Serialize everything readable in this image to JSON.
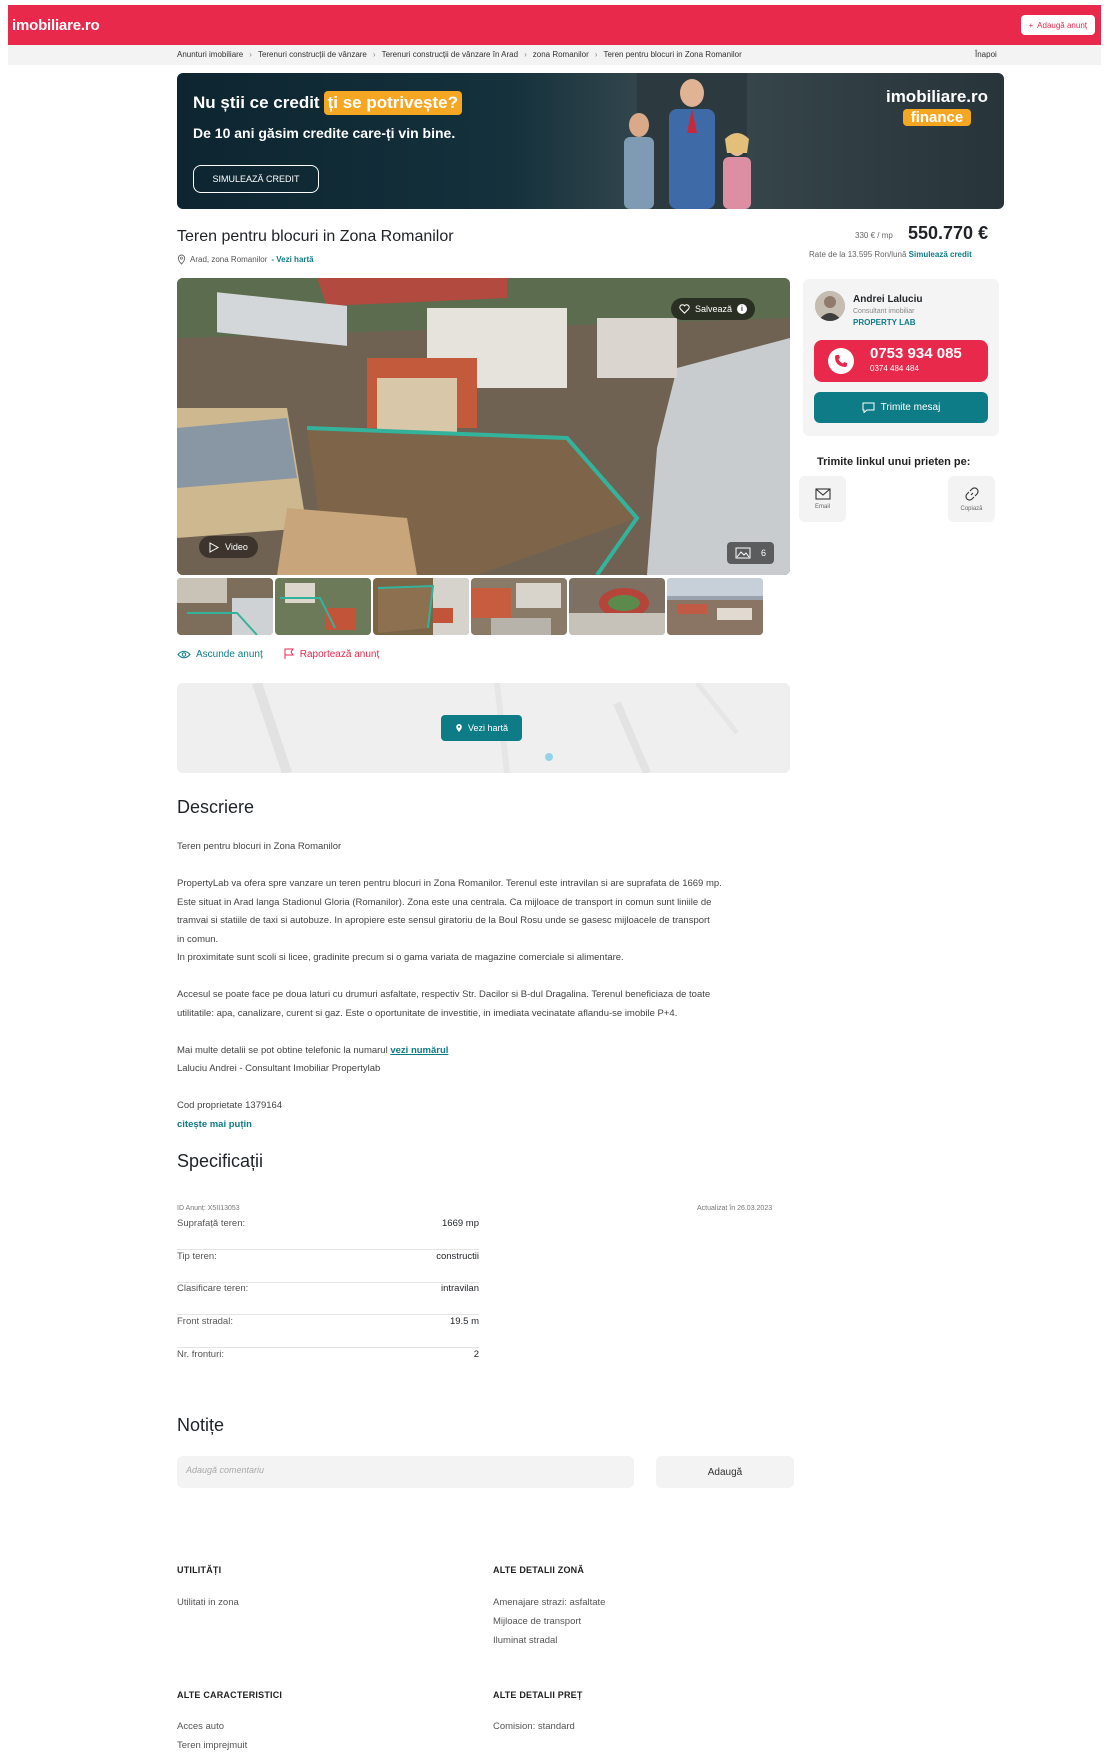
{
  "header": {
    "logo": "imobiliare.ro",
    "add_listing": "Adaugă anunț"
  },
  "breadcrumb": {
    "items": [
      "Anunturi imobiliare",
      "Terenuri construcții de vânzare",
      "Terenuri construcții de vânzare în Arad",
      "zona Romanilor",
      "Teren pentru blocuri in Zona Romanilor"
    ],
    "back": "Înapoi"
  },
  "banner": {
    "line1_a": "Nu știi ce credit",
    "line1_b": "ți se potrivește?",
    "line2": "De 10 ani găsim credite care-ți vin bine.",
    "cta": "SIMULEAZĂ CREDIT",
    "brand": "imobiliare.ro",
    "brand_sub": "finance"
  },
  "listing": {
    "title": "Teren pentru blocuri in Zona Romanilor",
    "location": "Arad, zona Romanilor",
    "map_link": "- Vezi hartă",
    "price_per_sqm": "330 € / mp",
    "price": "550.770 €",
    "rates_text": "Rate de la 13.595 Ron/lună",
    "rates_link": "Simulează credit"
  },
  "gallery": {
    "save": "Salvează",
    "info": "i",
    "video": "Video",
    "count": "6"
  },
  "actions": {
    "hide": "Ascunde anunț",
    "report": "Raportează anunț"
  },
  "map": {
    "button": "Vezi hartă"
  },
  "agent": {
    "name": "Andrei Laluciu",
    "role": "Consultant imobiliar",
    "company": "PROPERTY LAB",
    "phone": "0753 934 085",
    "phone2": "0374 484 484",
    "message": "Trimite mesaj"
  },
  "share": {
    "title": "Trimite linkul unui prieten pe:",
    "email": "Email",
    "copy": "Copiază"
  },
  "description": {
    "heading": "Descriere",
    "p1": "Teren pentru blocuri in Zona Romanilor",
    "p2a": "PropertyLab va ofera spre vanzare un teren pentru blocuri in Zona Romanilor. Terenul este intravilan si are suprafata de 1669 mp.",
    "p2b": "Este situat in Arad langa Stadionul Gloria (Romanilor). Zona este una centrala. Ca mijloace de transport in comun sunt liniile de",
    "p2c": "tramvai si statiile de taxi si autobuze. In apropiere este sensul giratoriu de la Boul Rosu unde se gasesc mijloacele de transport",
    "p2d": "in comun.",
    "p2e": "In proximitate sunt scoli si licee, gradinite precum si o gama variata de magazine comerciale si alimentare.",
    "p3a": "Accesul se poate face pe doua laturi cu drumuri asfaltate, respectiv Str. Dacilor si B-dul Dragalina. Terenul beneficiaza de toate",
    "p3b": "utilitatile: apa, canalizare, curent si gaz. Este o oportunitate de investitie, in imediata vecinatate aflandu-se imobile P+4.",
    "p4a": "Mai multe detalii se pot obtine telefonic la numarul",
    "p4_link": "vezi numărul",
    "p4b": "Laluciu Andrei - Consultant Imobiliar Propertylab",
    "code": "Cod proprietate 1379164",
    "read_less": "citește mai puțin"
  },
  "specs": {
    "heading": "Specificații",
    "id": "ID Anunț: X5II13053",
    "updated": "Actualizat în 26.03.2023",
    "rows": [
      {
        "label": "Suprafață teren:",
        "value": "1669 mp"
      },
      {
        "label": "Tip teren:",
        "value": "constructii"
      },
      {
        "label": "Clasificare teren:",
        "value": "intravilan"
      },
      {
        "label": "Front stradal:",
        "value": "19.5 m"
      },
      {
        "label": "Nr. fronturi:",
        "value": "2"
      }
    ]
  },
  "notes": {
    "heading": "Notițe",
    "placeholder": "Adaugă comentariu",
    "add": "Adaugă"
  },
  "details": {
    "utilities_h": "UTILITĂȚI",
    "utilities": [
      "Utilitati in zona"
    ],
    "zone_h": "ALTE DETALII ZONĂ",
    "zone": [
      "Amenajare strazi: asfaltate",
      "Mijloace de transport",
      "Iluminat stradal"
    ],
    "features_h": "ALTE CARACTERISTICI",
    "features": [
      "Acces auto",
      "Teren imprejmuit"
    ],
    "price_h": "ALTE DETALII PREȚ",
    "price": [
      "Comision: standard"
    ]
  }
}
